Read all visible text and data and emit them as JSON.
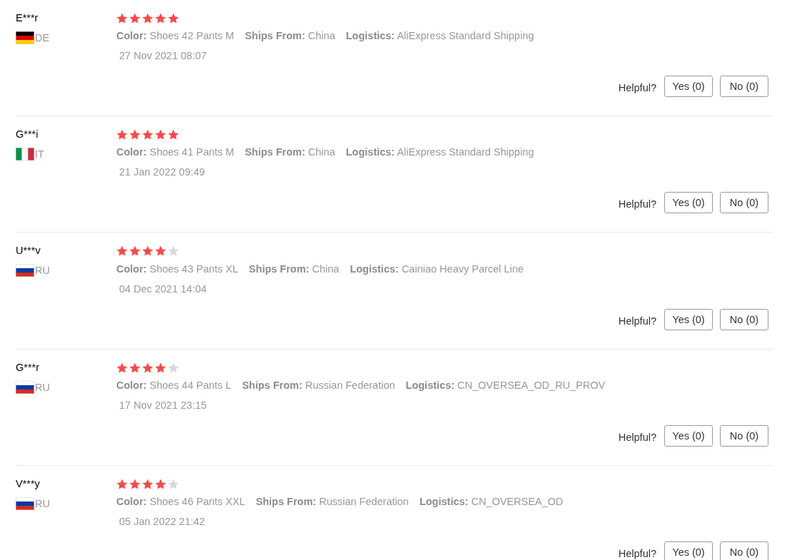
{
  "reviews": [
    {
      "user": "E***r",
      "flag": {
        "kind": "germany"
      },
      "country": "DE",
      "stars": 5,
      "attributes": [
        "**Color:** Shoes 42 Pants M",
        "**Ships From:** China",
        "**Logistics:** AliExpress Standard Shipping"
      ],
      "date": "27 Nov 2021 08:07",
      "helpful": {
        "label": "Helpful?",
        "yes": "Yes (0)",
        "no": "No (0)"
      }
    },
    {
      "user": "G***i",
      "flag": {
        "kind": "italy"
      },
      "country": "IT",
      "stars": 5,
      "attributes": [
        "**Color:** Shoes 41 Pants M",
        "**Ships From:** China",
        "**Logistics:** AliExpress Standard Shipping"
      ],
      "date": "21 Jan 2022 09:49",
      "helpful": {
        "label": "Helpful?",
        "yes": "Yes (0)",
        "no": "No (0)"
      }
    },
    {
      "user": "U***v",
      "flag": {
        "kind": "russia"
      },
      "country": "RU",
      "stars": 4,
      "attributes": [
        "**Color:** Shoes 43 Pants XL",
        "**Ships From:** China",
        "**Logistics:** Cainiao Heavy Parcel Line"
      ],
      "date": "04 Dec 2021 14:04",
      "helpful": {
        "label": "Helpful?",
        "yes": "Yes (0)",
        "no": "No (0)"
      }
    },
    {
      "user": "G***r",
      "flag": {
        "kind": "russia"
      },
      "country": "RU",
      "stars": 4,
      "attributes": [
        "**Color:** Shoes 44 Pants L",
        "**Ships From:** Russian Federation",
        "**Logistics:** CN_OVERSEA_OD_RU_PROV"
      ],
      "date": "17 Nov 2021 23:15",
      "helpful": {
        "label": "Helpful?",
        "yes": "Yes (0)",
        "no": "No (0)"
      }
    },
    {
      "user": "V***y",
      "flag": {
        "kind": "russia"
      },
      "country": "RU",
      "stars": 4,
      "attributes": [
        "**Color:** Shoes 46 Pants XXL",
        "**Ships From:** Russian Federation",
        "**Logistics:** CN_OVERSEA_OD"
      ],
      "date": "05 Jan 2022 21:42",
      "helpful": {
        "label": "Helpful?",
        "yes": "Yes (0)",
        "no": "No (0)"
      }
    }
  ]
}
